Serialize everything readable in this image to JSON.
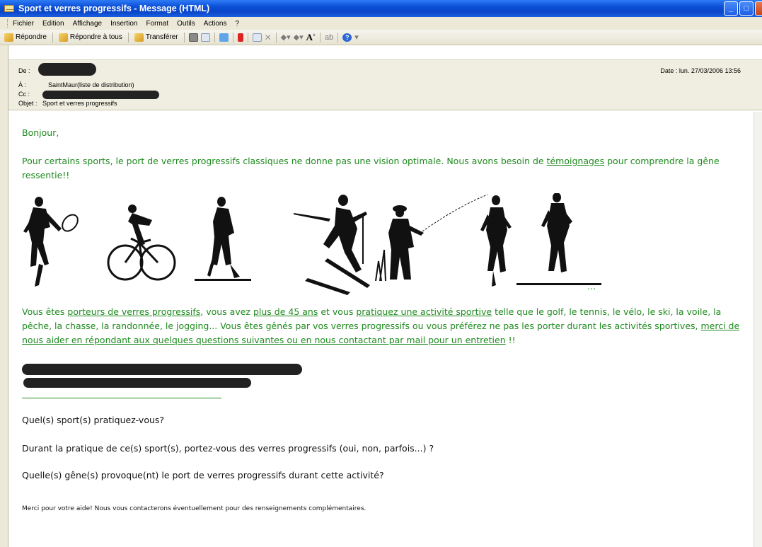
{
  "window": {
    "title": "Sport et verres progressifs - Message (HTML)"
  },
  "menu": [
    "Fichier",
    "Edition",
    "Affichage",
    "Insertion",
    "Format",
    "Outils",
    "Actions",
    "?"
  ],
  "toolbar": {
    "reply": "Répondre",
    "reply_all": "Répondre à tous",
    "forward": "Transférer"
  },
  "header": {
    "from_label": "De :",
    "to_label": "À :",
    "to_value": "SaintMaur(liste de distribution)",
    "cc_label": "Cc :",
    "subject_label": "Objet :",
    "subject_value": "Sport et verres progressifs",
    "date_label": "Date :",
    "date_value": "lun. 27/03/2006 13:56"
  },
  "message": {
    "greeting": "Bonjour,",
    "intro_before": "Pour certains sports, le port de verres progressifs classiques ne donne pas une vision optimale. Nous avons besoin de ",
    "intro_link": "témoignages",
    "intro_after": " pour comprendre la gêne ressentie!!",
    "ellipsis": "...",
    "p2": {
      "t1": "Vous êtes ",
      "l1": "porteurs de verres progressifs",
      "t2": ", vous avez ",
      "l2": "plus de 45 ans",
      "t3": " et vous ",
      "l3": "pratiquez une activité sportive",
      "t4": " telle  que le golf, le tennis, le vélo, le ski, la voile, la pêche, la chasse, la randonnée, le jogging...  Vous êtes gênés par vos verres progressifs ou vous préférez ne pas les porter durant les activités sportives, ",
      "l4": "merci de nous aider  en  répondant aux quelques questions suivantes  ou en nous contactant par mail pour un entretien",
      "t5": " !!"
    },
    "questions": [
      "Quel(s) sport(s) pratiquez-vous?",
      "Durant la pratique de ce(s) sport(s), portez-vous des verres progressifs (oui, non, parfois...) ?",
      "Quelle(s) gêne(s) provoque(nt) le port de verres progressifs durant cette activité?"
    ],
    "thanks": "Merci pour votre aide! Nous vous contacterons éventuellement pour des renseignements complémentaires."
  }
}
